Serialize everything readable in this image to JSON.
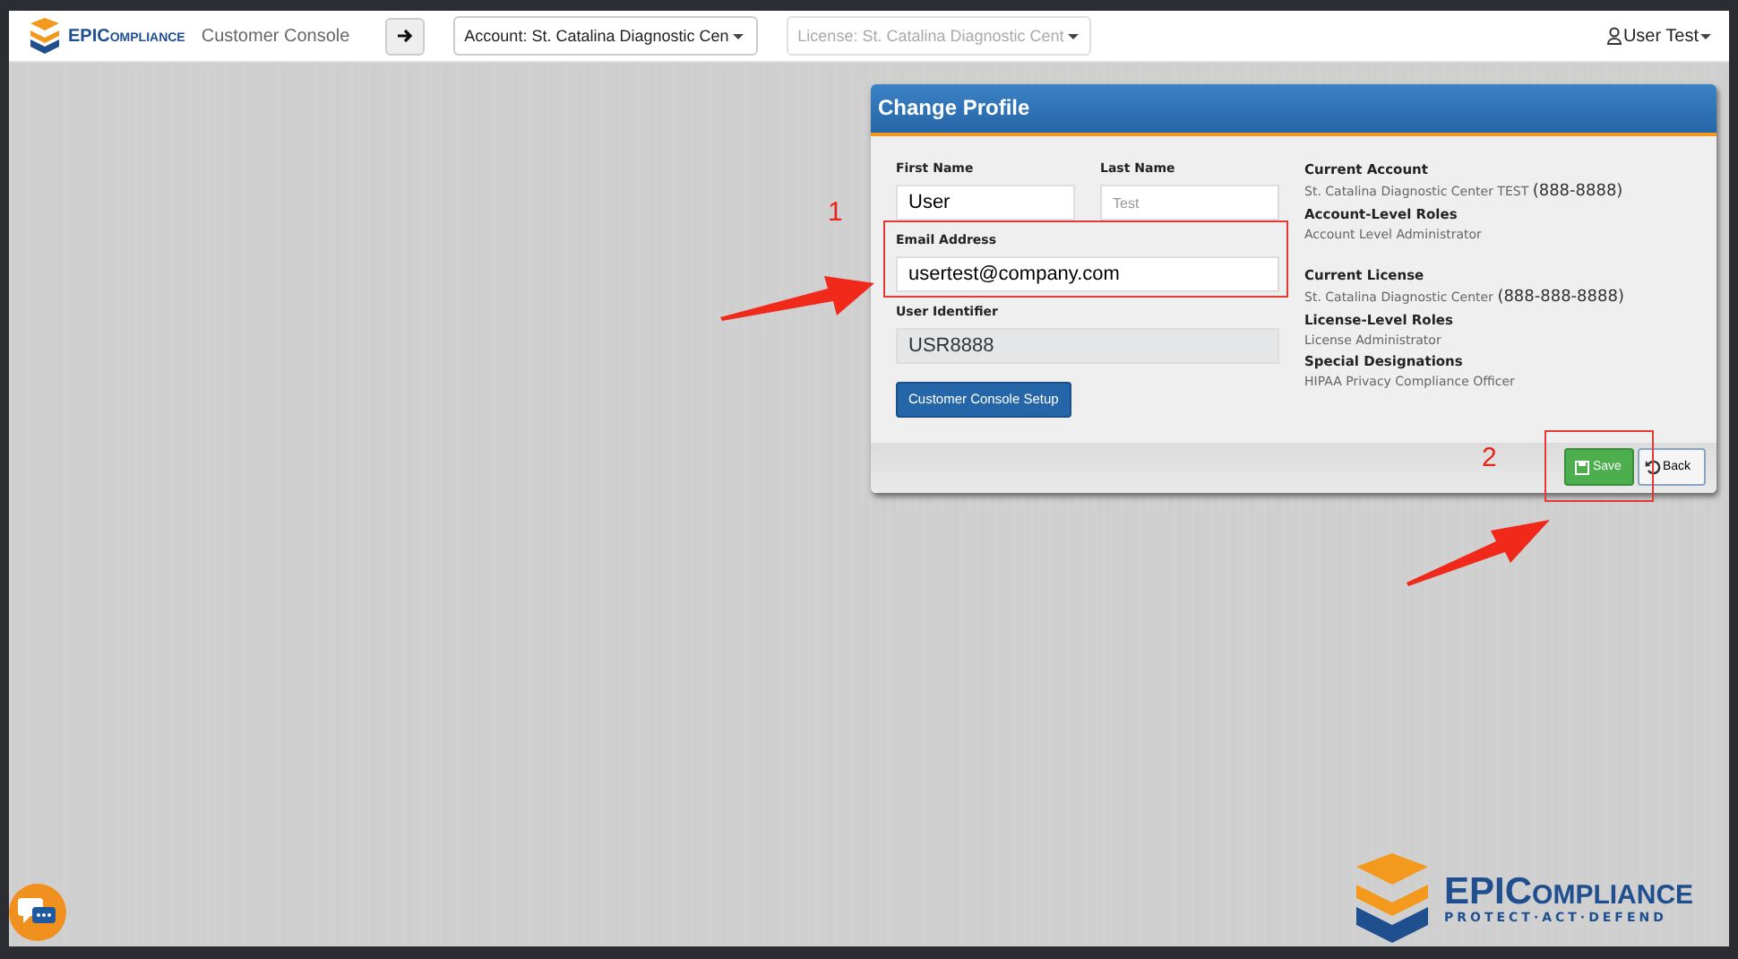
{
  "header": {
    "brand": {
      "strong": "EPI",
      "rest": "Compliance"
    },
    "app_title": "Customer Console",
    "account_select": {
      "value": "Account: St. Catalina Diagnostic Cen",
      "disabled": false
    },
    "license_select": {
      "value": "License: St. Catalina Diagnostic Cent",
      "disabled": true
    },
    "user_menu": "User Test"
  },
  "dialog": {
    "title": "Change Profile",
    "fields": [
      {
        "label": "First Name",
        "value": "User",
        "kind": "half"
      },
      {
        "label": "Last Name",
        "placeholder": "Test",
        "kind": "half"
      },
      {
        "label": "Email Address",
        "value": "usertest@company.com",
        "kind": "full",
        "highlighted": true
      },
      {
        "label": "User Identifier",
        "value": "USR8888",
        "kind": "full",
        "disabled": true
      }
    ],
    "setup_button": "Customer Console Setup",
    "info": [
      {
        "heading": "Current Account",
        "text": "St. Catalina Diagnostic Center TEST",
        "extra": "(888-8888)"
      },
      {
        "heading": "Account-Level Roles",
        "text": "Account Level Administrator",
        "gap_after": true
      },
      {
        "heading": "Current License",
        "text": "St. Catalina Diagnostic Center",
        "extra": "(888-888-8888)"
      },
      {
        "heading": "License-Level Roles",
        "text": "License Administrator"
      },
      {
        "heading": "Special Designations",
        "text": "HIPAA Privacy Compliance Officer"
      }
    ],
    "save_button": "Save",
    "back_button": "Back"
  },
  "annotations": [
    {
      "number": "1"
    },
    {
      "number": "2"
    }
  ],
  "footer_logo": {
    "strong": "EPI",
    "rest": "Compliance",
    "tagline": "PROTECT·ACT·DEFEND"
  }
}
